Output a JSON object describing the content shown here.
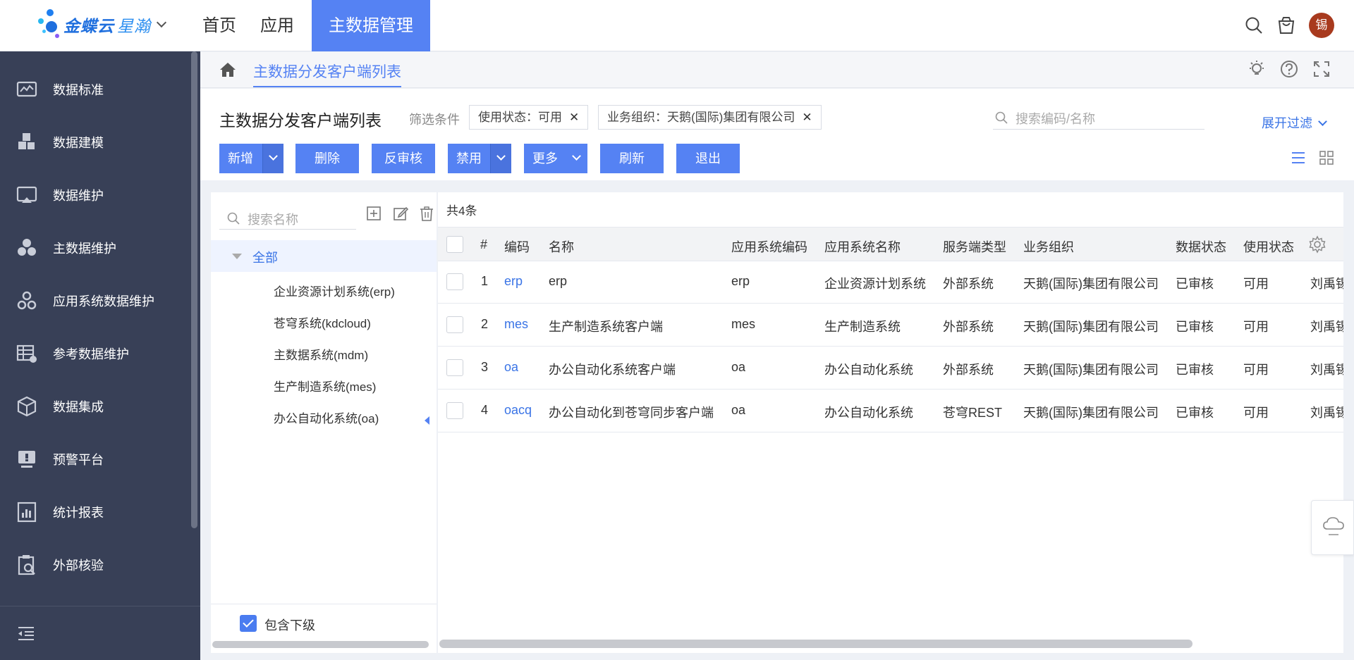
{
  "brand": {
    "name": "金蝶云",
    "sub": "星瀚",
    "colors": {
      "primary": "#5582f3",
      "sidebar": "#384057",
      "link": "#3a74e6"
    }
  },
  "topnav": [
    {
      "label": "首页"
    },
    {
      "label": "应用"
    },
    {
      "label": "主数据管理",
      "active": true
    }
  ],
  "user": {
    "avatar_text": "锡"
  },
  "sidebar": {
    "items": [
      {
        "label": "数据标准",
        "icon": "chart-monitor-icon"
      },
      {
        "label": "数据建模",
        "icon": "blocks-icon"
      },
      {
        "label": "数据维护",
        "icon": "monitor-icon"
      },
      {
        "label": "主数据维护",
        "icon": "circles-icon"
      },
      {
        "label": "应用系统数据维护",
        "icon": "gears-icon"
      },
      {
        "label": "参考数据维护",
        "icon": "table-gear-icon"
      },
      {
        "label": "数据集成",
        "icon": "cube-icon"
      },
      {
        "label": "预警平台",
        "icon": "alert-screen-icon"
      },
      {
        "label": "统计报表",
        "icon": "report-icon"
      },
      {
        "label": "外部核验",
        "icon": "clipboard-search-icon"
      }
    ]
  },
  "breadcrumb": {
    "tab": "主数据分发客户端列表"
  },
  "main": {
    "title": "主数据分发客户端列表",
    "filter_label": "筛选条件",
    "chips": [
      {
        "label": "使用状态：可用"
      },
      {
        "label": "业务组织：天鹅(国际)集团有限公司"
      }
    ],
    "search_placeholder": "搜索编码/名称",
    "expand_filter": "展开过滤"
  },
  "toolbar": {
    "add": "新增",
    "delete": "删除",
    "unaudit": "反审核",
    "disable": "禁用",
    "more": "更多",
    "refresh": "刷新",
    "exit": "退出"
  },
  "tree": {
    "search_placeholder": "搜索名称",
    "root": "全部",
    "nodes": [
      {
        "label": "企业资源计划系统(erp)"
      },
      {
        "label": "苍穹系统(kdcloud)"
      },
      {
        "label": "主数据系统(mdm)"
      },
      {
        "label": "生产制造系统(mes)"
      },
      {
        "label": "办公自动化系统(oa)"
      }
    ],
    "include_sub": "包含下级",
    "include_sub_checked": true
  },
  "grid": {
    "count": "共4条",
    "headers": [
      "#",
      "编码",
      "名称",
      "应用系统编码",
      "应用系统名称",
      "服务端类型",
      "业务组织",
      "数据状态",
      "使用状态"
    ],
    "rows": [
      {
        "num": "1",
        "code": "erp",
        "name": "erp",
        "app_code": "erp",
        "app_name": "企业资源计划系统",
        "server_type": "外部系统",
        "org": "天鹅(国际)集团有限公司",
        "data_status": "已审核",
        "use_status": "可用",
        "extra": "刘禹锡"
      },
      {
        "num": "2",
        "code": "mes",
        "name": "生产制造系统客户端",
        "app_code": "mes",
        "app_name": "生产制造系统",
        "server_type": "外部系统",
        "org": "天鹅(国际)集团有限公司",
        "data_status": "已审核",
        "use_status": "可用",
        "extra": "刘禹锡"
      },
      {
        "num": "3",
        "code": "oa",
        "name": "办公自动化系统客户端",
        "app_code": "oa",
        "app_name": "办公自动化系统",
        "server_type": "外部系统",
        "org": "天鹅(国际)集团有限公司",
        "data_status": "已审核",
        "use_status": "可用",
        "extra": "刘禹锡"
      },
      {
        "num": "4",
        "code": "oacq",
        "name": "办公自动化到苍穹同步客户端",
        "app_code": "oa",
        "app_name": "办公自动化系统",
        "server_type": "苍穹REST",
        "org": "天鹅(国际)集团有限公司",
        "data_status": "已审核",
        "use_status": "可用",
        "extra": "刘禹锡"
      }
    ]
  }
}
